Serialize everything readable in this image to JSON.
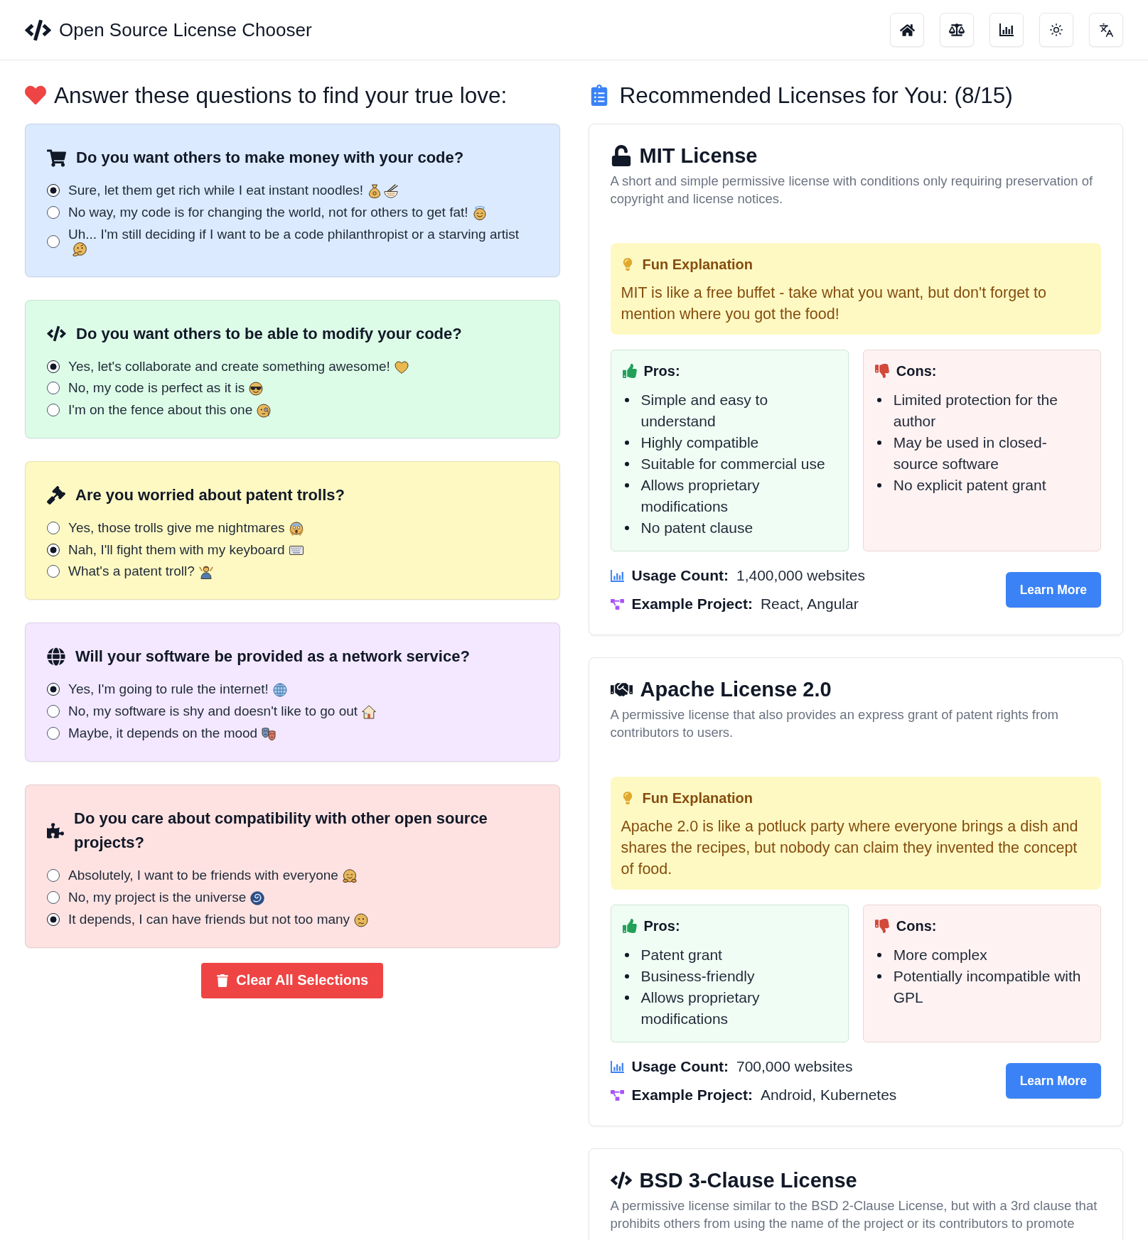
{
  "header": {
    "title": "Open Source License Chooser"
  },
  "questionnaire": {
    "heading": "Answer these questions to find your true love:",
    "questions": [
      {
        "color": "#dbeafe",
        "question": "Do you want others to make money with your code?",
        "options": [
          {
            "label": "Sure, let them get rich while I eat instant noodles!",
            "selected": true
          },
          {
            "label": "No way, my code is for changing the world, not for others to get fat!",
            "selected": false
          },
          {
            "label": "Uh... I'm still deciding if I want to be a code philanthropist or a starving artist",
            "selected": false
          }
        ]
      },
      {
        "color": "#dcfce7",
        "question": "Do you want others to be able to modify your code?",
        "options": [
          {
            "label": "Yes, let's collaborate and create something awesome!",
            "selected": true
          },
          {
            "label": "No, my code is perfect as it is",
            "selected": false
          },
          {
            "label": "I'm on the fence about this one",
            "selected": false
          }
        ]
      },
      {
        "color": "#fef9c3",
        "question": "Are you worried about patent trolls?",
        "options": [
          {
            "label": "Yes, those trolls give me nightmares",
            "selected": false
          },
          {
            "label": "Nah, I'll fight them with my keyboard",
            "selected": true
          },
          {
            "label": "What's a patent troll?",
            "selected": false
          }
        ]
      },
      {
        "color": "#f3e8ff",
        "question": "Will your software be provided as a network service?",
        "options": [
          {
            "label": "Yes, I'm going to rule the internet!",
            "selected": true
          },
          {
            "label": "No, my software is shy and doesn't like to go out",
            "selected": false
          },
          {
            "label": "Maybe, it depends on the mood",
            "selected": false
          }
        ]
      },
      {
        "color": "#fee2e2",
        "question": "Do you care about compatibility with other open source projects?",
        "options": [
          {
            "label": "Absolutely, I want to be friends with everyone",
            "selected": false
          },
          {
            "label": "No, my project is the universe",
            "selected": false
          },
          {
            "label": "It depends, I can have friends but not too many",
            "selected": true
          }
        ]
      }
    ],
    "clear_button": "Clear All Selections"
  },
  "recommendations": {
    "heading": "Recommended Licenses for You: (8/15)",
    "licenses": [
      {
        "name": "MIT License",
        "description": "A short and simple permissive license with conditions only requiring preservation of copyright and license notices.",
        "fun_title": "Fun Explanation",
        "fun_text": "MIT is like a free buffet - take what you want, but don't forget to mention where you got the food!",
        "pros_title": "Pros:",
        "pros": [
          "Simple and easy to understand",
          "Highly compatible",
          "Suitable for commercial use",
          "Allows proprietary modifications",
          "No patent clause"
        ],
        "cons_title": "Cons:",
        "cons": [
          "Limited protection for the author",
          "May be used in closed-source software",
          "No explicit patent grant"
        ],
        "usage_label": "Usage Count:",
        "usage": "1,400,000 websites",
        "project_label": "Example Project:",
        "project": "React, Angular",
        "button": "Learn More"
      },
      {
        "name": "Apache License 2.0",
        "description": "A permissive license that also provides an express grant of patent rights from contributors to users.",
        "fun_title": "Fun Explanation",
        "fun_text": "Apache 2.0 is like a potluck party where everyone brings a dish and shares the recipes, but nobody can claim they invented the concept of food.",
        "pros_title": "Pros:",
        "pros": [
          "Patent grant",
          "Business-friendly",
          "Allows proprietary modifications"
        ],
        "cons_title": "Cons:",
        "cons": [
          "More complex",
          "Potentially incompatible with GPL"
        ],
        "usage_label": "Usage Count:",
        "usage": "700,000 websites",
        "project_label": "Example Project:",
        "project": "Android, Kubernetes",
        "button": "Learn More"
      },
      {
        "name": "BSD 3-Clause License",
        "description": "A permissive license similar to the BSD 2-Clause License, but with a 3rd clause that prohibits others from using the name of the project or its contributors to promote"
      }
    ]
  }
}
